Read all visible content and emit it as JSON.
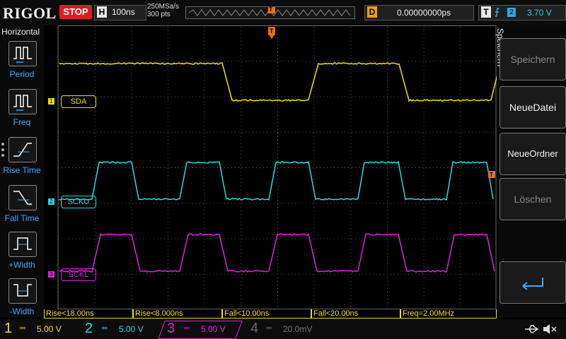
{
  "header": {
    "brand": "RIGOL",
    "run_state": "STOP",
    "timebase_letter": "H",
    "timebase": "100ns",
    "sample_rate": "250MSa/s",
    "memory_depth": "300 pts",
    "trigger_marker": "T",
    "delay_letter": "D",
    "delay": "0.00000000ps",
    "trigger_letter": "T",
    "trigger_edge": "⨍",
    "trigger_source": "2",
    "trigger_level": "3.70 V"
  },
  "left_menu": {
    "title": "Horizontal",
    "items": [
      {
        "label": "Period"
      },
      {
        "label": "Freq"
      },
      {
        "label": "Rise Time"
      },
      {
        "label": "Fall Time"
      },
      {
        "label": "+Width"
      },
      {
        "label": "-Width"
      }
    ]
  },
  "right_menu": {
    "title": "Speichern",
    "items": [
      {
        "label": "Speichern",
        "enabled": false
      },
      {
        "label": "NeueDatei",
        "enabled": true
      },
      {
        "label": "NeueOrdner",
        "enabled": true
      },
      {
        "label": "Löschen",
        "enabled": false
      }
    ]
  },
  "channels": [
    {
      "num": "1",
      "label": "SDA",
      "color": "#f0e000",
      "scale": "5.00 V"
    },
    {
      "num": "2",
      "label": "SCKU",
      "color": "#28d8e8",
      "scale": "5.00 V"
    },
    {
      "num": "3",
      "label": "SCKL",
      "color": "#e020e0",
      "scale": "5.00 V"
    },
    {
      "num": "4",
      "label": "",
      "color": "#555555",
      "scale": "20.0mV"
    }
  ],
  "measurements": [
    "Rise<18.00ns",
    "Rise<8.000ns",
    "Fall<10.00ns",
    "Fall<20.00ns",
    "Freq=2.00MHz"
  ],
  "status_icons": [
    "usb-icon",
    "speaker-mute-icon"
  ],
  "colors": {
    "accent": "#3da8ff",
    "stop": "#d82020",
    "trigger": "#f0a000"
  }
}
